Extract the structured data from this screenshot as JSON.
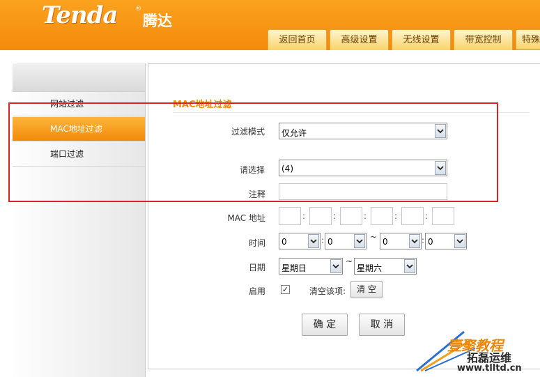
{
  "header": {
    "logo_text": "Tenda",
    "logo_reg": "®",
    "logo_cn": "腾达"
  },
  "top_nav": [
    {
      "label": "返回首页"
    },
    {
      "label": "高级设置"
    },
    {
      "label": "无线设置"
    },
    {
      "label": "带宽控制"
    },
    {
      "label": "特殊"
    }
  ],
  "sidebar": {
    "items": [
      {
        "label": "网站过滤",
        "active": false
      },
      {
        "label": "MAC地址过滤",
        "active": true
      },
      {
        "label": "端口过滤",
        "active": false
      }
    ]
  },
  "form": {
    "section_title": "MAC地址过滤",
    "filter_mode": {
      "label": "过滤模式",
      "value": "仅允许"
    },
    "choose": {
      "label": "请选择",
      "value": "(4)"
    },
    "note": {
      "label": "注释",
      "value": ""
    },
    "mac": {
      "label": "MAC 地址",
      "octets": [
        "",
        "",
        "",
        "",
        "",
        ""
      ],
      "separator": ":"
    },
    "time": {
      "label": "时间",
      "start_hour": "0",
      "start_min": "0",
      "end_hour": "0",
      "end_min": "0",
      "separator": ":",
      "range": "~"
    },
    "date": {
      "label": "日期",
      "start_day": "星期日",
      "end_day": "星期六",
      "range": "~"
    },
    "enable": {
      "label": "启用",
      "checked": true,
      "check_mark": "✓"
    },
    "clear": {
      "label": "清空该项:",
      "button": "清 空"
    },
    "ok_button": "确 定",
    "cancel_button": "取 消"
  },
  "watermark": {
    "line1": "壹聚教程",
    "line2": "拓磊运维",
    "line3": "www.tlltd.cn"
  },
  "colors": {
    "brand_orange": "#f58a0c",
    "highlight_red": "#d9232b",
    "title_orange": "#f08a00"
  }
}
